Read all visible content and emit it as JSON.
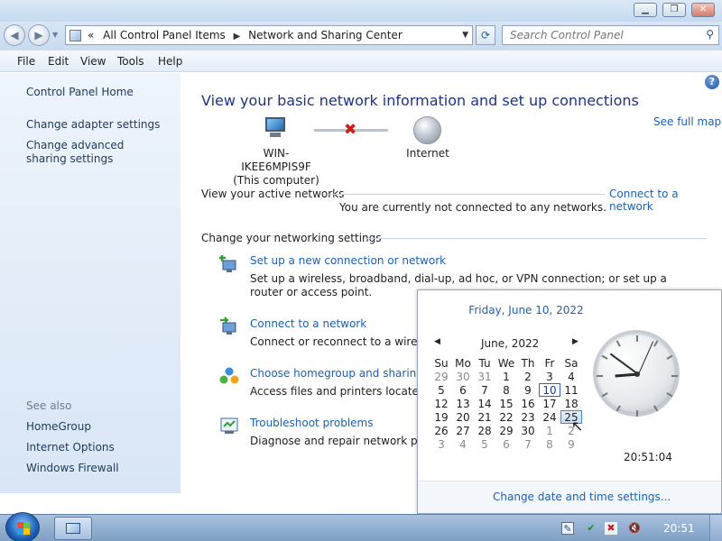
{
  "address_bar": {
    "overflow": "«",
    "crumbs": [
      "All Control Panel Items",
      "Network and Sharing Center"
    ],
    "search_placeholder": "Search Control Panel"
  },
  "menu": [
    "File",
    "Edit",
    "View",
    "Tools",
    "Help"
  ],
  "left_pane": {
    "home": "Control Panel Home",
    "links": [
      "Change adapter settings",
      "Change advanced sharing settings"
    ],
    "see_also_header": "See also",
    "see_also": [
      "HomeGroup",
      "Internet Options",
      "Windows Firewall"
    ]
  },
  "main": {
    "heading": "View your basic network information and set up connections",
    "see_full_map": "See full map",
    "computer_name": "WIN-IKEE6MPIS9F",
    "computer_caption": "(This computer)",
    "internet_label": "Internet",
    "active_networks_label": "View your active networks",
    "connect_link": "Connect to a network",
    "not_connected": "You are currently not connected to any networks.",
    "change_settings_label": "Change your networking settings",
    "tasks": [
      {
        "title": "Set up a new connection or network",
        "desc": "Set up a wireless, broadband, dial-up, ad hoc, or VPN connection; or set up a router or access point."
      },
      {
        "title": "Connect to a network",
        "desc": "Connect or reconnect to a wireless,"
      },
      {
        "title": "Choose homegroup and sharing op",
        "desc": "Access files and printers located on"
      },
      {
        "title": "Troubleshoot problems",
        "desc": "Diagnose and repair network proble"
      }
    ]
  },
  "calendar": {
    "date_header": "Friday, June 10, 2022",
    "month_label": "June, 2022",
    "weekdays": [
      "Su",
      "Mo",
      "Tu",
      "We",
      "Th",
      "Fr",
      "Sa"
    ],
    "weeks": [
      [
        "29",
        "30",
        "31",
        "1",
        "2",
        "3",
        "4"
      ],
      [
        "5",
        "6",
        "7",
        "8",
        "9",
        "10",
        "11"
      ],
      [
        "12",
        "13",
        "14",
        "15",
        "16",
        "17",
        "18"
      ],
      [
        "19",
        "20",
        "21",
        "22",
        "23",
        "24",
        "25"
      ],
      [
        "26",
        "27",
        "28",
        "29",
        "30",
        "1",
        "2"
      ],
      [
        "3",
        "4",
        "5",
        "6",
        "7",
        "8",
        "9"
      ]
    ],
    "today": "10",
    "hovered": "25",
    "clock_time": "20:51:04",
    "footer_link": "Change date and time settings..."
  },
  "taskbar": {
    "time": "20:51"
  },
  "colors": {
    "link": "#1e5fb3",
    "heading": "#1e3287",
    "taskbar": "#8fadd0"
  }
}
